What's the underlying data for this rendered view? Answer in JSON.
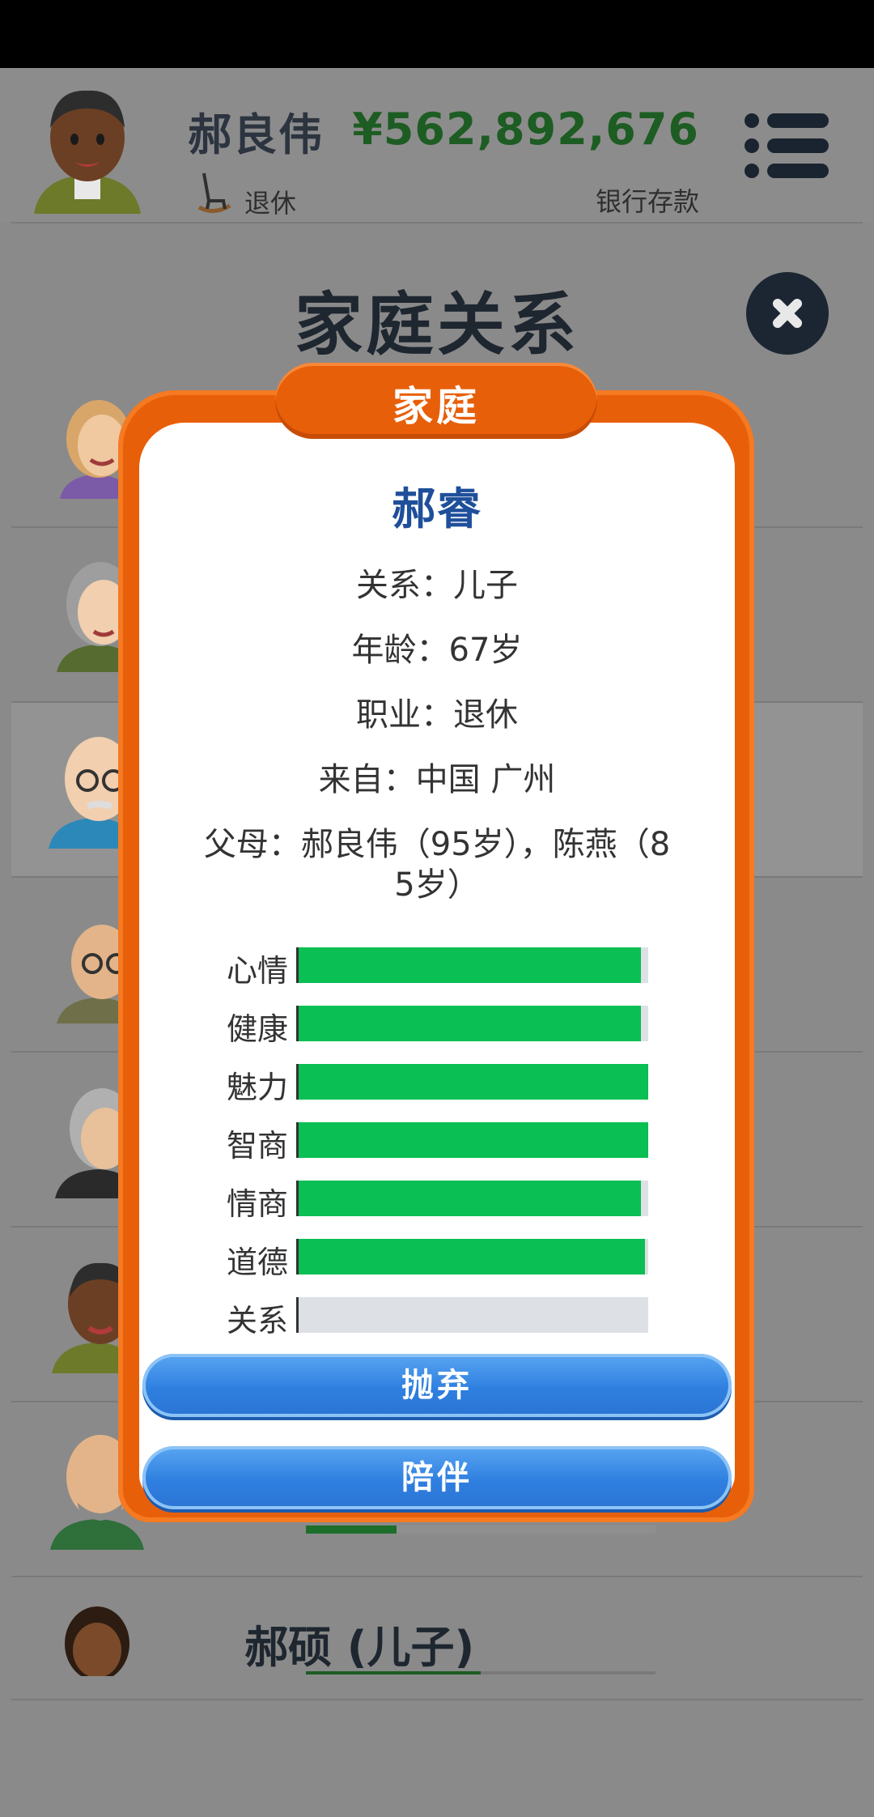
{
  "header": {
    "player_name": "郝良伟",
    "job_label": "退休",
    "money": "¥562,892,676",
    "money_label": "银行存款"
  },
  "page": {
    "title": "家庭关系"
  },
  "background_list": {
    "last_row_name": "郝硕 (儿子)"
  },
  "modal": {
    "tab_label": "家庭",
    "person_name": "郝睿",
    "info_lines": [
      "关系：儿子",
      "年龄：67岁",
      "职业：退休",
      "来自：中国 广州",
      "父母：郝良伟（95岁），陈燕（8",
      "5岁）"
    ],
    "stats": [
      {
        "label": "心情",
        "value": 0.98
      },
      {
        "label": "健康",
        "value": 0.98
      },
      {
        "label": "魅力",
        "value": 1.0
      },
      {
        "label": "智商",
        "value": 1.0
      },
      {
        "label": "情商",
        "value": 0.98
      },
      {
        "label": "道德",
        "value": 0.99
      },
      {
        "label": "关系",
        "value": 0.0
      }
    ],
    "buttons": {
      "abandon": "抛弃",
      "accompany": "陪伴"
    }
  },
  "colors": {
    "modal_orange": "#e85f0a",
    "stat_green": "#0abf53",
    "button_blue": "#2f7fe0",
    "name_blue": "#1f4f9a"
  },
  "icons": [
    "rocking-chair-icon",
    "menu-icon",
    "close-icon"
  ]
}
